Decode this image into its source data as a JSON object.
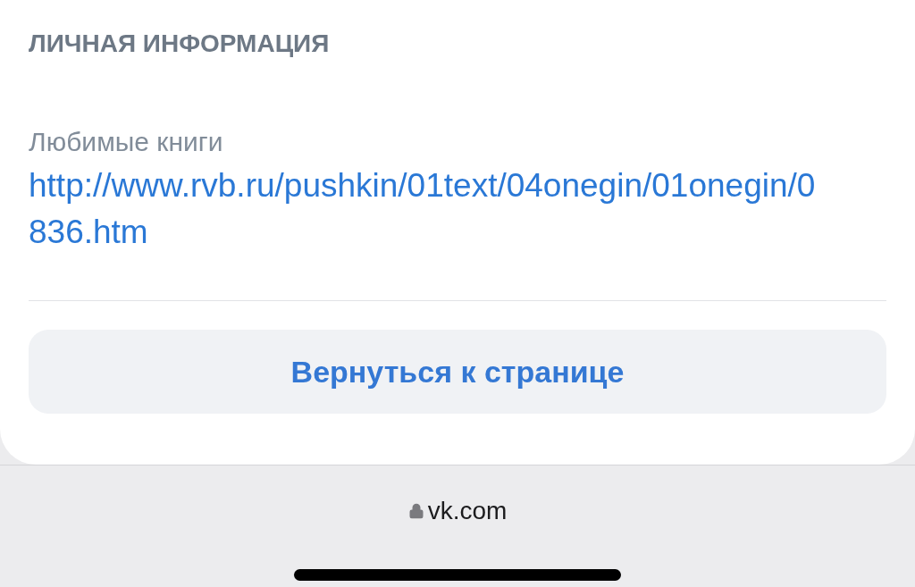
{
  "section": {
    "title": "ЛИЧНАЯ ИНФОРМАЦИЯ"
  },
  "field": {
    "label": "Любимые книги",
    "link": "http://www.rvb.ru/pushkin/01text/04onegin/01onegin/0836.htm"
  },
  "button": {
    "label": "Вернуться к странице"
  },
  "address_bar": {
    "url": "vk.com",
    "secure": true
  }
}
